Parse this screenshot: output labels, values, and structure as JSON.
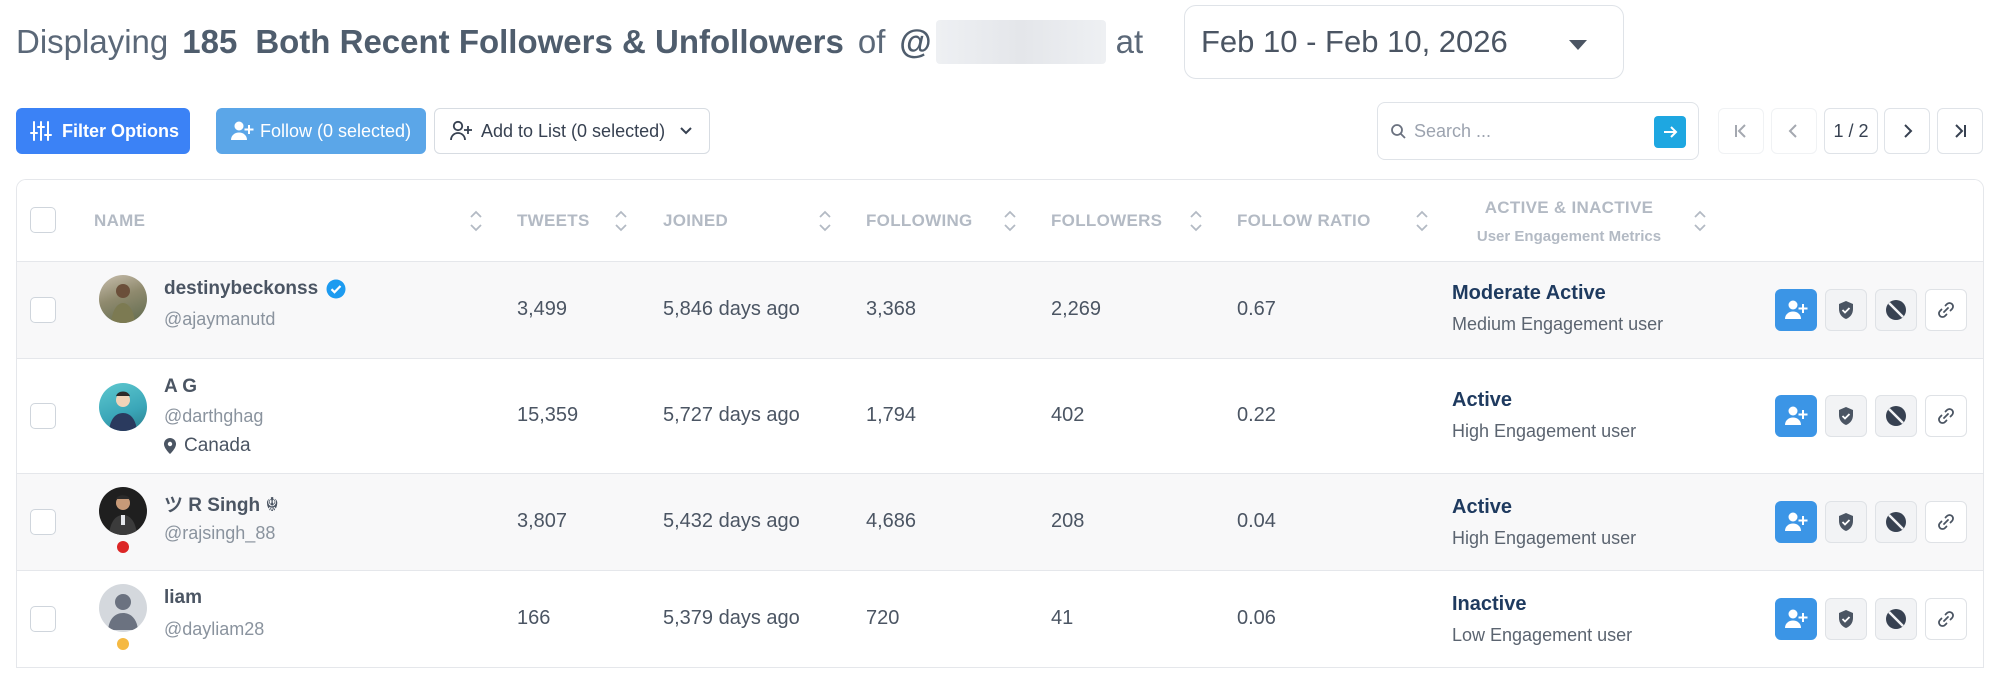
{
  "header": {
    "displaying": "Displaying",
    "count": "185",
    "type": "Both Recent Followers & Unfollowers",
    "of": "of",
    "at_sign": "@",
    "at": "at",
    "date_range": "Feb 10 - Feb 10, 2026"
  },
  "toolbar": {
    "filter_label": "Filter Options",
    "follow_label": "Follow (0 selected)",
    "add_to_list_label": "Add to List (0 selected)",
    "search_placeholder": "Search ...",
    "page_indicator": "1 / 2"
  },
  "columns": {
    "name": "NAME",
    "tweets": "TWEETS",
    "joined": "JOINED",
    "following": "FOLLOWING",
    "followers": "FOLLOWERS",
    "ratio": "FOLLOW RATIO",
    "activity": "ACTIVE & INACTIVE",
    "activity_sub": "User Engagement Metrics"
  },
  "rows": [
    {
      "name": "destinybeckonss",
      "handle": "@ajaymanutd",
      "location": "",
      "tweets": "3,499",
      "joined": "5,846 days ago",
      "following": "3,368",
      "followers": "2,269",
      "ratio": "0.67",
      "status": "Moderate Active",
      "engagement": "Medium Engagement user"
    },
    {
      "name": "A G",
      "handle": "@darthghag",
      "location": "Canada",
      "tweets": "15,359",
      "joined": "5,727 days ago",
      "following": "1,794",
      "followers": "402",
      "ratio": "0.22",
      "status": "Active",
      "engagement": "High Engagement user"
    },
    {
      "name": "ツ R Singh ☬",
      "handle": "@rajsingh_88",
      "location": "",
      "tweets": "3,807",
      "joined": "5,432 days ago",
      "following": "4,686",
      "followers": "208",
      "ratio": "0.04",
      "status": "Active",
      "engagement": "High Engagement user"
    },
    {
      "name": "liam",
      "handle": "@dayliam28",
      "location": "",
      "tweets": "166",
      "joined": "5,379 days ago",
      "following": "720",
      "followers": "41",
      "ratio": "0.06",
      "status": "Inactive",
      "engagement": "Low Engagement user"
    }
  ],
  "colors": {
    "primary": "#3b82f6",
    "follow": "#5ba6e8",
    "status_text": "#1e3a5f",
    "verified": "#1d9bf0",
    "online_red": "#dc2626",
    "online_amber": "#f5b942"
  }
}
